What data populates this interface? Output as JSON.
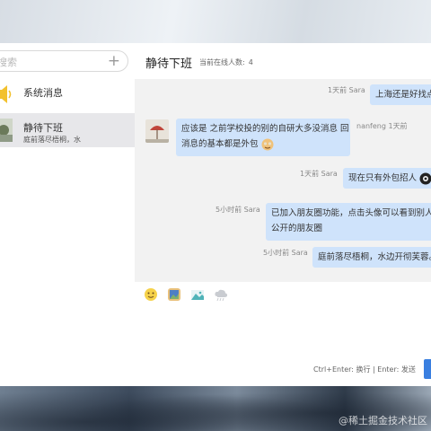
{
  "sidebar": {
    "search_placeholder": "搜索",
    "conversations": [
      {
        "title": "系统消息",
        "subtitle": ""
      },
      {
        "title": "静待下班",
        "subtitle": "庭前落尽梧桐，水"
      }
    ]
  },
  "chat": {
    "title": "静待下班",
    "online_label": "当前在线人数:",
    "online_count": "4",
    "messages": [
      {
        "meta": "1天前 Sara",
        "text": "上海还是好找点"
      },
      {
        "meta": "nanfeng 1天前",
        "text_line1": "应该是 之前学校投的别的自研大多没消息 回",
        "text_line2": "消息的基本都是外包"
      },
      {
        "meta": "1天前 Sara",
        "text": "现在只有外包招人"
      },
      {
        "meta": "5小时前 Sara",
        "text_line1": "已加入朋友圈功能，点击头像可以看到别人",
        "text_line2": "公开的朋友圈"
      },
      {
        "meta": "5小时前 Sara",
        "text": "庭前落尽梧桐，水边开彻芙蓉。"
      }
    ],
    "send_hint": "Ctrl+Enter: 换行 | Enter: 发送"
  },
  "watermark": "@稀土掘金技术社区",
  "colors": {
    "bubble": "#cfe3fb",
    "accent": "#3a7fe0",
    "active_conversation": "#e7e7ea"
  }
}
